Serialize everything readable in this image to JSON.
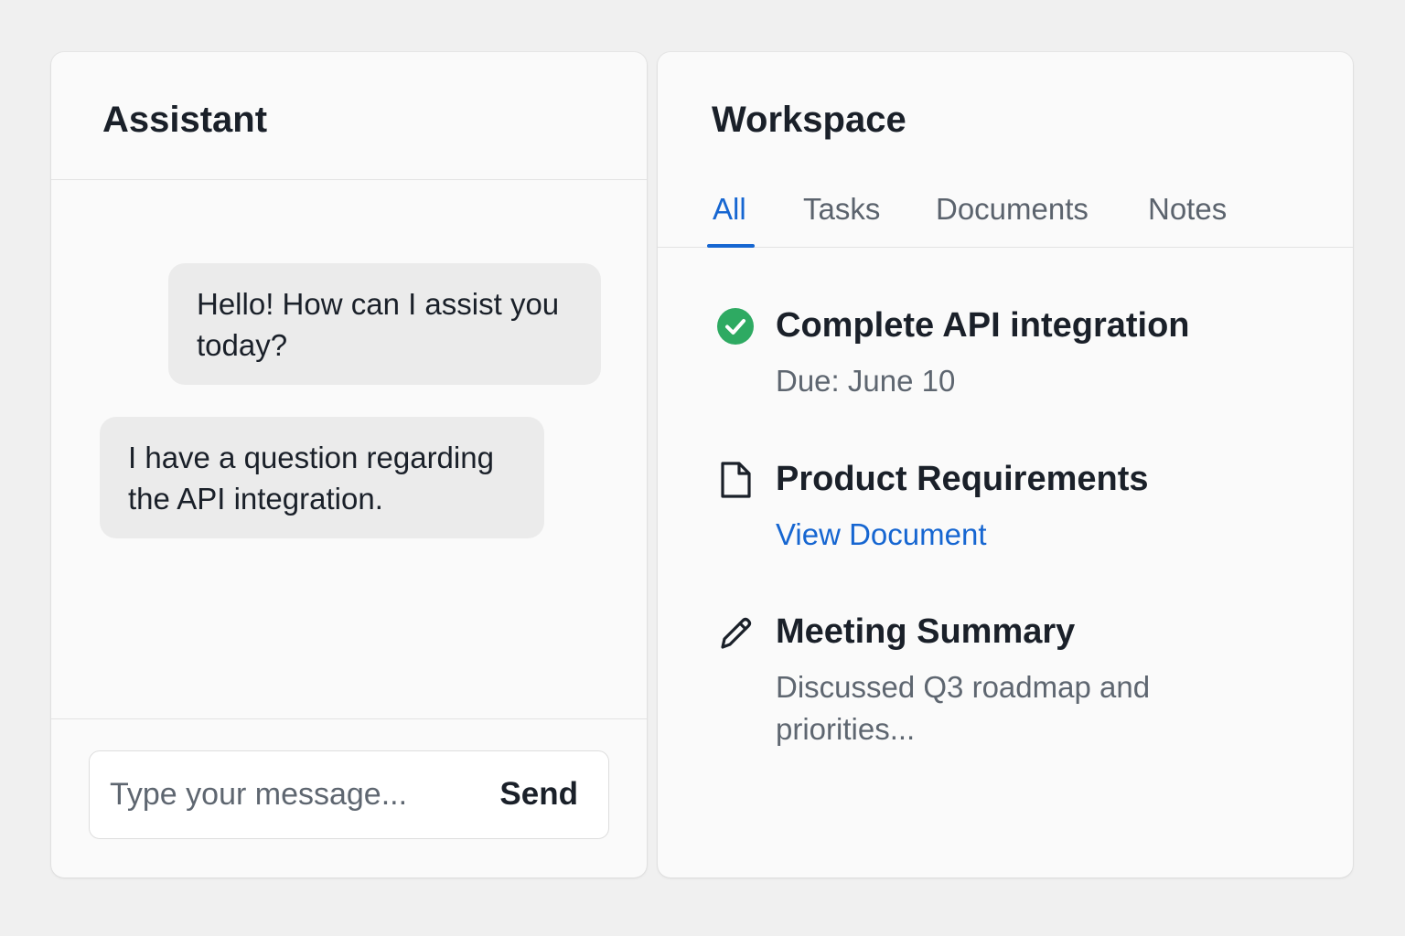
{
  "assistant": {
    "title": "Assistant",
    "messages": [
      {
        "role": "assistant",
        "text": "Hello! How can I assist you today?"
      },
      {
        "role": "user",
        "text": "I have a question regarding the API integration."
      }
    ],
    "composer": {
      "placeholder": "Type your message...",
      "value": "",
      "send_label": "Send"
    }
  },
  "workspace": {
    "title": "Workspace",
    "tabs": [
      {
        "label": "All",
        "active": true
      },
      {
        "label": "Tasks",
        "active": false
      },
      {
        "label": "Documents",
        "active": false
      },
      {
        "label": "Notes",
        "active": false
      }
    ],
    "items": [
      {
        "icon": "check-circle-icon",
        "title": "Complete API integration",
        "subtitle": "Due: June 10",
        "status": "completed"
      },
      {
        "icon": "document-icon",
        "title": "Product Requirements",
        "link": "View Document"
      },
      {
        "icon": "pencil-icon",
        "title": "Meeting Summary",
        "subtitle": "Discussed Q3 roadmap and priorities..."
      }
    ]
  },
  "colors": {
    "accent": "#1666d1",
    "success": "#2eaa62",
    "background": "#f0f0f0",
    "panel": "#fafafa",
    "bubble": "#ebebeb"
  }
}
